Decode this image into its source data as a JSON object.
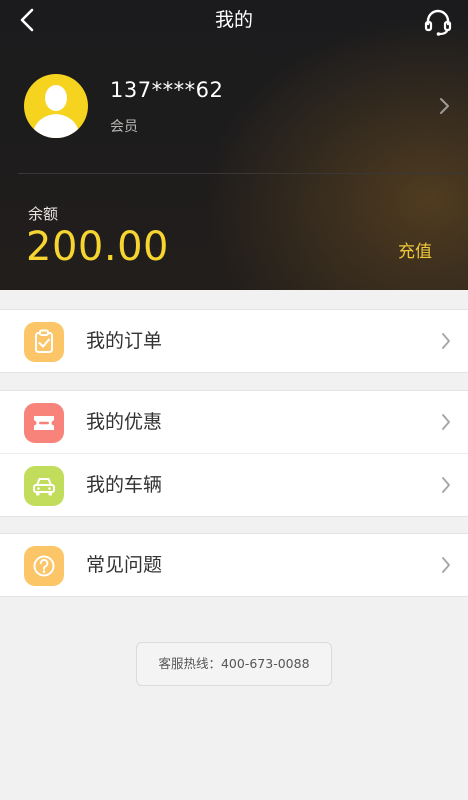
{
  "header": {
    "title": "我的",
    "back_icon": "back-arrow-icon",
    "service_icon": "headset-icon"
  },
  "profile": {
    "phone": "137****62",
    "member_label": "会员"
  },
  "balance": {
    "label": "余额",
    "value": "200.00",
    "recharge_label": "充值"
  },
  "menu_groups": [
    {
      "items": [
        {
          "label": "我的订单",
          "icon": "clipboard-check-icon",
          "icon_color": "#fbc568"
        }
      ]
    },
    {
      "items": [
        {
          "label": "我的优惠",
          "icon": "coupon-icon",
          "icon_color": "#f7837a"
        },
        {
          "label": "我的车辆",
          "icon": "car-icon",
          "icon_color": "#c2dc5c"
        }
      ]
    },
    {
      "items": [
        {
          "label": "常见问题",
          "icon": "question-icon",
          "icon_color": "#fbc568"
        }
      ]
    }
  ],
  "hotline": {
    "text": "客服热线：400-673-0088"
  },
  "colors": {
    "accent_yellow": "#f6d530",
    "header_dark": "#1c1b1c",
    "background": "#f2f1f1"
  }
}
